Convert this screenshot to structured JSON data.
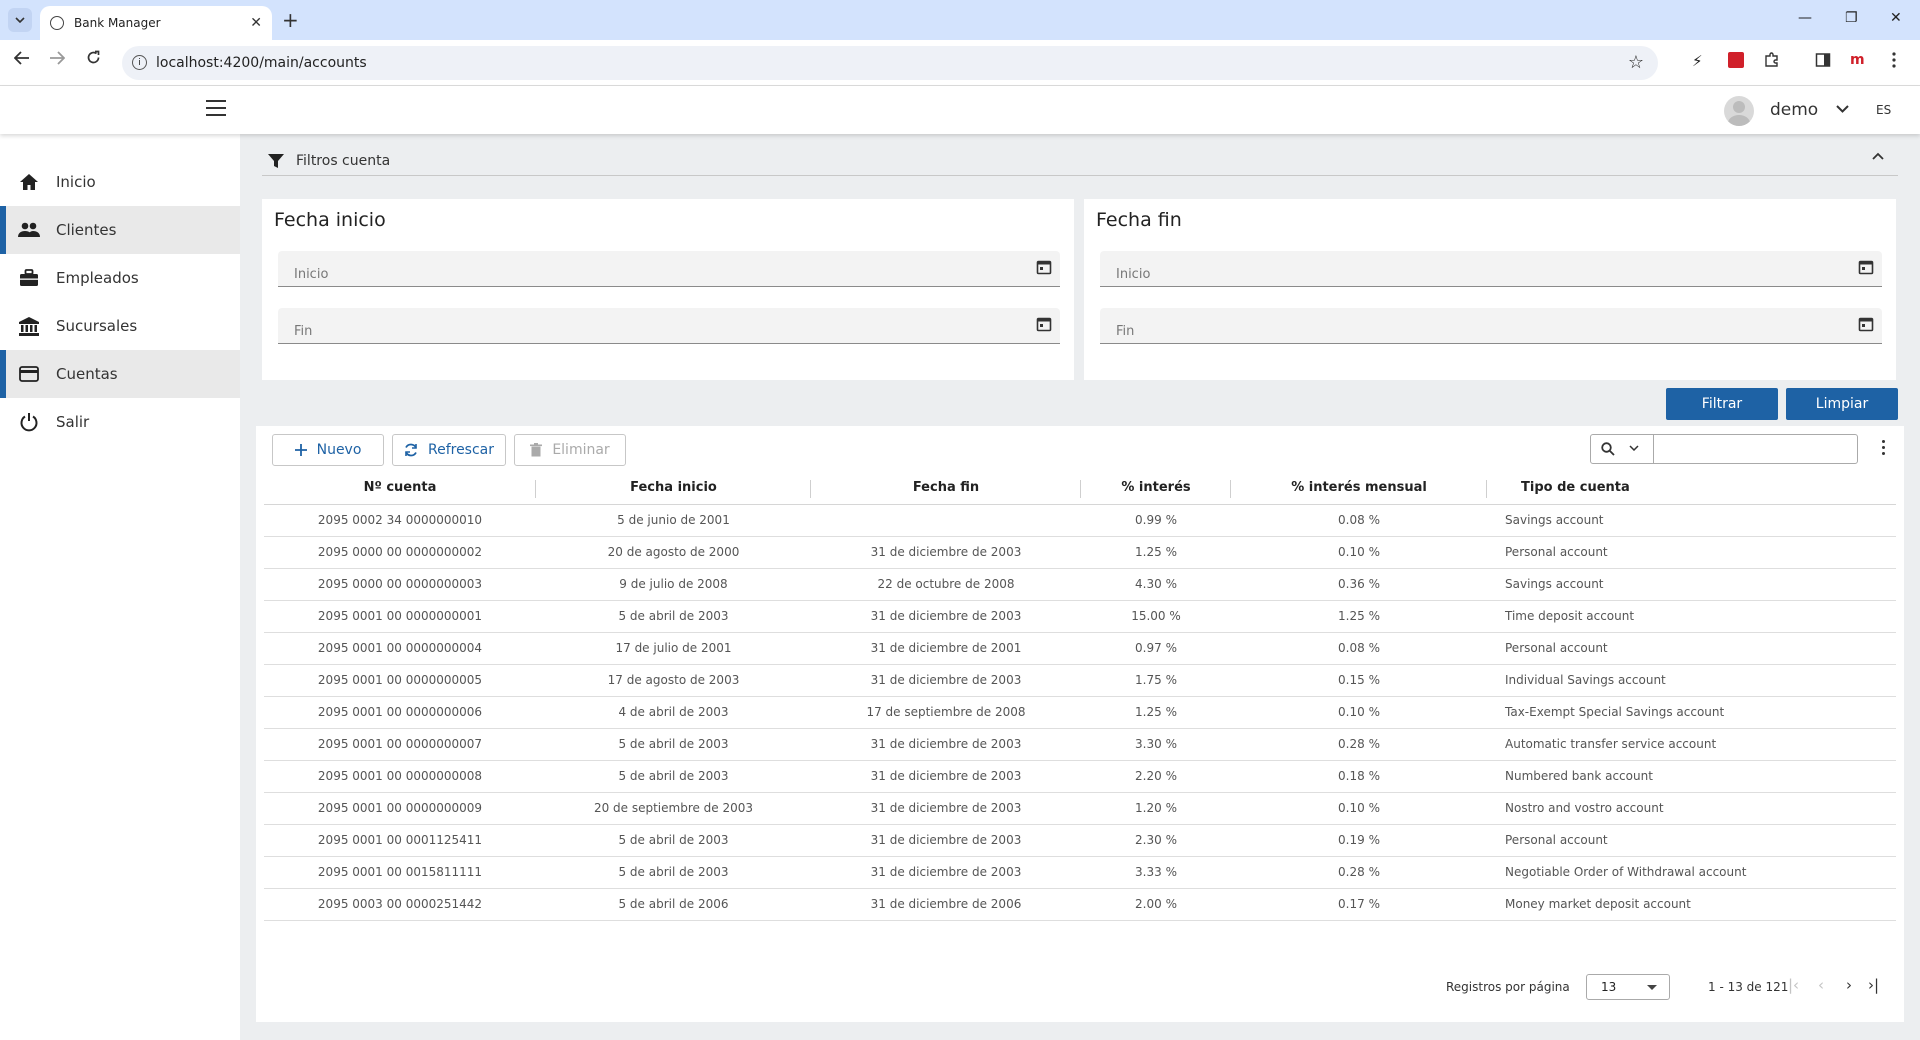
{
  "browser": {
    "tab_title": "Bank Manager",
    "url": "localhost:4200/main/accounts",
    "new_tab": "+",
    "close_tab": "✕",
    "win_min": "—",
    "win_restore": "❐",
    "win_close": "✕",
    "ext_label": "m"
  },
  "header": {
    "user": "demo",
    "lang": "ES"
  },
  "sidebar": {
    "items": [
      {
        "label": "Inicio",
        "icon": "home-icon"
      },
      {
        "label": "Clientes",
        "icon": "people-icon"
      },
      {
        "label": "Empleados",
        "icon": "briefcase-icon"
      },
      {
        "label": "Sucursales",
        "icon": "bank-icon"
      },
      {
        "label": "Cuentas",
        "icon": "credit-card-icon"
      },
      {
        "label": "Salir",
        "icon": "power-icon"
      }
    ]
  },
  "filters": {
    "title": "Filtros cuenta",
    "start_panel": {
      "title": "Fecha inicio",
      "from_placeholder": "Inicio",
      "to_placeholder": "Fin"
    },
    "end_panel": {
      "title": "Fecha fin",
      "from_placeholder": "Inicio",
      "to_placeholder": "Fin"
    },
    "filter_button": "Filtrar",
    "clear_button": "Limpiar",
    "accent_color": "#1e62a5"
  },
  "toolbar": {
    "new_label": "Nuevo",
    "refresh_label": "Refrescar",
    "delete_label": "Eliminar"
  },
  "table": {
    "columns": [
      "Nº cuenta",
      "Fecha inicio",
      "Fecha fin",
      "% interés",
      "% interés mensual",
      "Tipo de cuenta"
    ],
    "rows": [
      [
        "2095 0002 34 0000000010",
        "5 de junio de 2001",
        "",
        "0.99 %",
        "0.08 %",
        "Savings account"
      ],
      [
        "2095 0000 00 0000000002",
        "20 de agosto de 2000",
        "31 de diciembre de 2003",
        "1.25 %",
        "0.10 %",
        "Personal account"
      ],
      [
        "2095 0000 00 0000000003",
        "9 de julio de 2008",
        "22 de octubre de 2008",
        "4.30 %",
        "0.36 %",
        "Savings account"
      ],
      [
        "2095 0001 00 0000000001",
        "5 de abril de 2003",
        "31 de diciembre de 2003",
        "15.00 %",
        "1.25 %",
        "Time deposit account"
      ],
      [
        "2095 0001 00 0000000004",
        "17 de julio de 2001",
        "31 de diciembre de 2001",
        "0.97 %",
        "0.08 %",
        "Personal account"
      ],
      [
        "2095 0001 00 0000000005",
        "17 de agosto de 2003",
        "31 de diciembre de 2003",
        "1.75 %",
        "0.15 %",
        "Individual Savings account"
      ],
      [
        "2095 0001 00 0000000006",
        "4 de abril de 2003",
        "17 de septiembre de 2008",
        "1.25 %",
        "0.10 %",
        "Tax-Exempt Special Savings account"
      ],
      [
        "2095 0001 00 0000000007",
        "5 de abril de 2003",
        "31 de diciembre de 2003",
        "3.30 %",
        "0.28 %",
        "Automatic transfer service account"
      ],
      [
        "2095 0001 00 0000000008",
        "5 de abril de 2003",
        "31 de diciembre de 2003",
        "2.20 %",
        "0.18 %",
        "Numbered bank account"
      ],
      [
        "2095 0001 00 0000000009",
        "20 de septiembre de 2003",
        "31 de diciembre de 2003",
        "1.20 %",
        "0.10 %",
        "Nostro and vostro account"
      ],
      [
        "2095 0001 00 0001125411",
        "5 de abril de 2003",
        "31 de diciembre de 2003",
        "2.30 %",
        "0.19 %",
        "Personal account"
      ],
      [
        "2095 0001 00 0015811111",
        "5 de abril de 2003",
        "31 de diciembre de 2003",
        "3.33 %",
        "0.28 %",
        "Negotiable Order of Withdrawal account"
      ],
      [
        "2095 0003 00 0000251442",
        "5 de abril de 2006",
        "31 de diciembre de 2006",
        "2.00 %",
        "0.17 %",
        "Money market deposit account"
      ]
    ]
  },
  "pagination": {
    "rows_label": "Registros por página",
    "page_size": "13",
    "range": "1 - 13 de 121",
    "first": "|‹",
    "prev": "‹",
    "next": "›",
    "last": "›|"
  }
}
